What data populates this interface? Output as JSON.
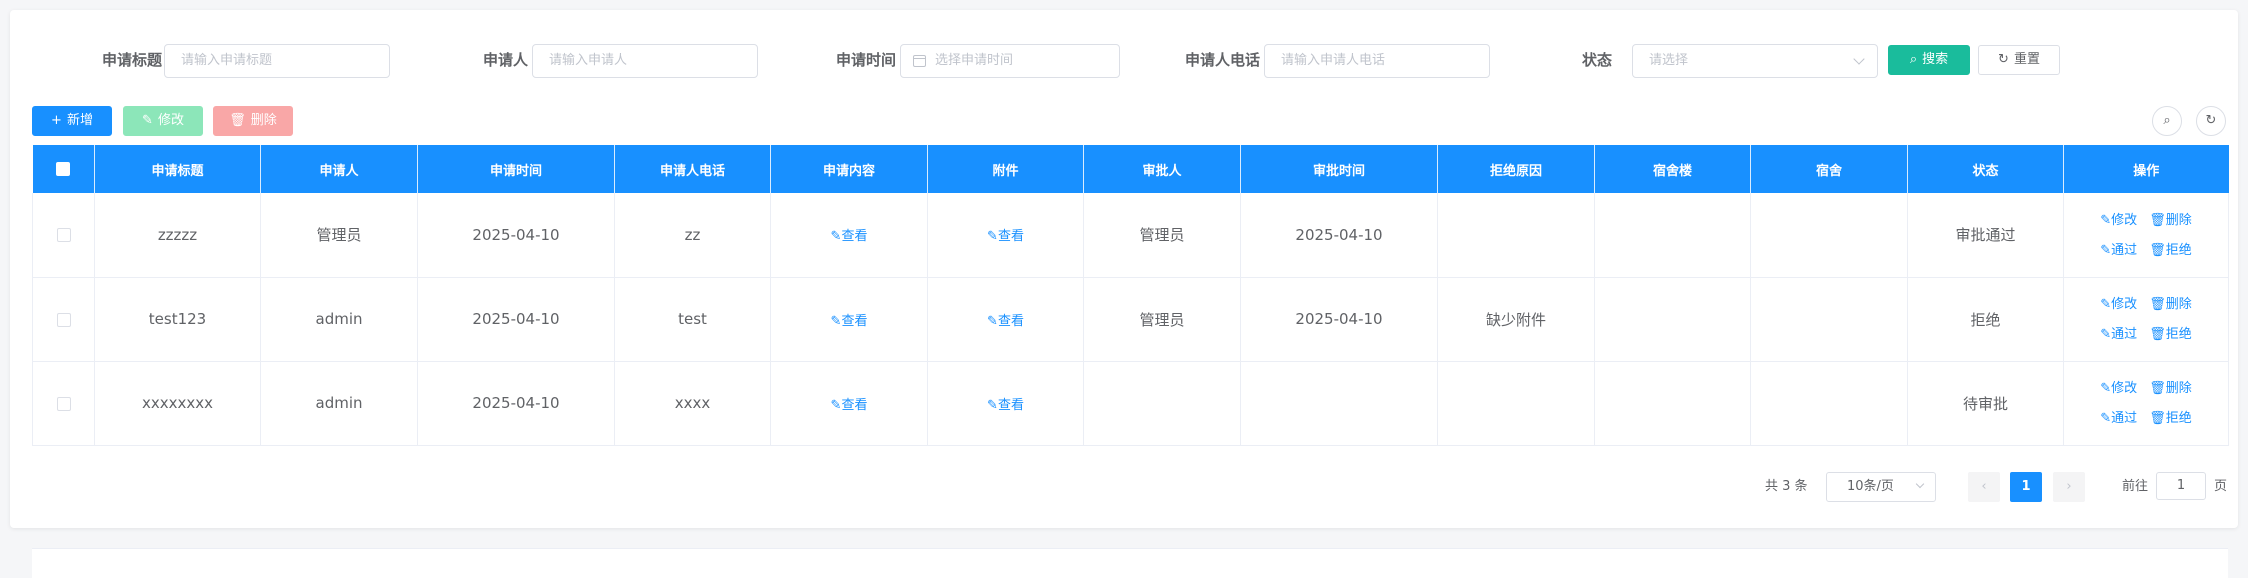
{
  "search": {
    "title_label": "申请标题",
    "title_placeholder": "请输入申请标题",
    "applicant_label": "申请人",
    "applicant_placeholder": "请输入申请人",
    "time_label": "申请时间",
    "time_placeholder": "选择申请时间",
    "phone_label": "申请人电话",
    "phone_placeholder": "请输入申请人电话",
    "status_label": "状态",
    "status_placeholder": "请选择",
    "search_btn": "搜索",
    "reset_btn": "重置"
  },
  "toolbar": {
    "add": "新增",
    "edit": "修改",
    "delete": "删除"
  },
  "table": {
    "headers": [
      "申请标题",
      "申请人",
      "申请时间",
      "申请人电话",
      "申请内容",
      "附件",
      "审批人",
      "审批时间",
      "拒绝原因",
      "宿舍楼",
      "宿舍",
      "状态",
      "操作"
    ],
    "view_text": "查看",
    "ops": {
      "edit": "修改",
      "delete": "删除",
      "approve": "通过",
      "reject": "拒绝"
    },
    "rows": [
      {
        "title": "zzzzz",
        "applicant": "管理员",
        "time": "2025-04-10",
        "phone": "zz",
        "approver": "管理员",
        "approve_time": "2025-04-10",
        "reason": "",
        "building": "",
        "dorm": "",
        "status": "审批通过"
      },
      {
        "title": "test123",
        "applicant": "admin",
        "time": "2025-04-10",
        "phone": "test",
        "approver": "管理员",
        "approve_time": "2025-04-10",
        "reason": "缺少附件",
        "building": "",
        "dorm": "",
        "status": "拒绝"
      },
      {
        "title": "xxxxxxxx",
        "applicant": "admin",
        "time": "2025-04-10",
        "phone": "xxxx",
        "approver": "",
        "approve_time": "",
        "reason": "",
        "building": "",
        "dorm": "",
        "status": "待审批"
      }
    ]
  },
  "pagination": {
    "total": "共 3 条",
    "page_size": "10条/页",
    "current": "1",
    "goto_label": "前往",
    "goto_value": "1",
    "page_unit": "页",
    "prev": "‹",
    "next": "›"
  },
  "colors": {
    "primary": "#1890ff",
    "search": "#1abc9c",
    "edit": "#8ce6b9",
    "delete": "#f9a7a7"
  }
}
